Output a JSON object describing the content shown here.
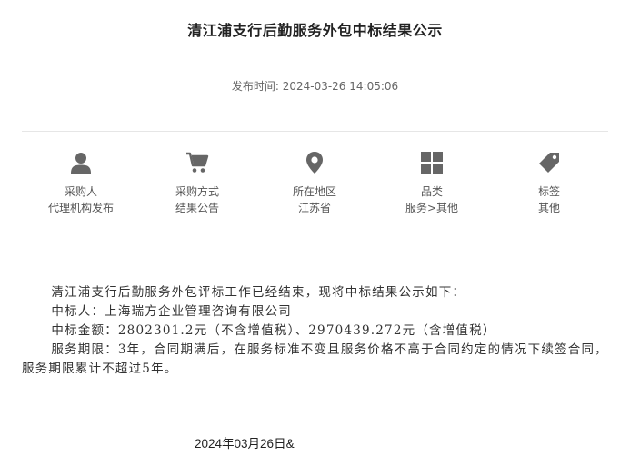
{
  "title": "清江浦支行后勤服务外包中标结果公示",
  "publish": {
    "label": "发布时间:",
    "value": "2024-03-26 14:05:06"
  },
  "meta": {
    "purchaser": {
      "icon": "user-icon",
      "line1": "采购人",
      "line2": "代理机构发布"
    },
    "method": {
      "icon": "cart-icon",
      "line1": "采购方式",
      "line2": "结果公告"
    },
    "region": {
      "icon": "location-pin-icon",
      "line1": "所在地区",
      "line2": "江苏省"
    },
    "category": {
      "icon": "grid-icon",
      "line1": "品类",
      "line2": "服务>其他"
    },
    "tag": {
      "icon": "tag-icon",
      "line1": "标签",
      "line2": "其他"
    }
  },
  "content": {
    "p1": "清江浦支行后勤服务外包评标工作已经结束，现将中标结果公示如下：",
    "p2": "中标人：上海瑞方企业管理咨询有限公司",
    "p3": "中标金额：2802301.2元（不含增值税）、2970439.272元（含增值税）",
    "p4": "服务期限：3年，合同期满后，在服务标准不变且服务价格不高于合同约定的情况下续签合同，服务期限累计不超过5年。"
  },
  "date_line": "2024年03月26日&",
  "colors": {
    "icon": "#666666",
    "text": "#333333",
    "rule": "#e6e6e6"
  }
}
